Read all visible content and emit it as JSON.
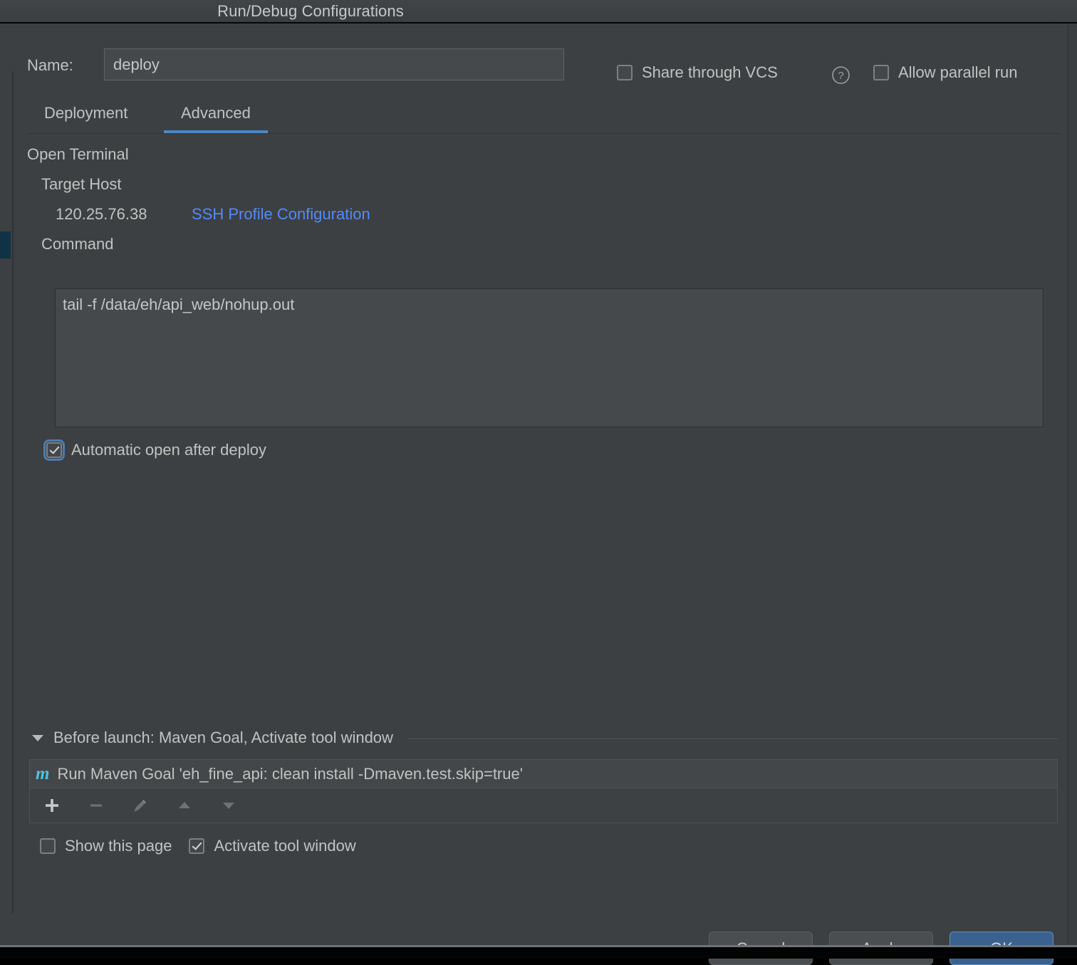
{
  "window": {
    "title": "Run/Debug Configurations"
  },
  "header": {
    "name_label": "Name:",
    "name_value": "deploy",
    "share_vcs_label": "Share through VCS",
    "share_vcs_checked": false,
    "help_icon": "question-circle-icon",
    "allow_parallel_label": "Allow parallel run",
    "allow_parallel_checked": false
  },
  "tabs": [
    {
      "label": "Deployment",
      "selected": false
    },
    {
      "label": "Advanced",
      "selected": true
    }
  ],
  "advanced": {
    "open_terminal_label": "Open Terminal",
    "target_host_label": "Target Host",
    "target_host_value": "120.25.76.38",
    "ssh_profile_link": "SSH Profile Configuration",
    "command_label": "Command",
    "command_value": "tail -f /data/eh/api_web/nohup.out",
    "automatic_open_label": "Automatic open after deploy",
    "automatic_open_checked": true
  },
  "before_launch": {
    "title": "Before launch: Maven Goal, Activate tool window",
    "expanded": true,
    "items": [
      {
        "icon": "maven-icon",
        "text": "Run Maven Goal 'eh_fine_api: clean install -Dmaven.test.skip=true'"
      }
    ],
    "toolbar": [
      {
        "name": "add-button",
        "icon": "plus-icon",
        "enabled": true
      },
      {
        "name": "remove-button",
        "icon": "minus-icon",
        "enabled": false
      },
      {
        "name": "edit-button",
        "icon": "pencil-icon",
        "enabled": false
      },
      {
        "name": "move-up-button",
        "icon": "arrow-up-icon",
        "enabled": false
      },
      {
        "name": "move-down-button",
        "icon": "arrow-down-icon",
        "enabled": false
      }
    ],
    "show_this_page_label": "Show this page",
    "show_this_page_checked": false,
    "activate_tool_window_label": "Activate tool window",
    "activate_tool_window_checked": true
  },
  "footer": {
    "cancel_label": "Cancel",
    "apply_label": "Apply",
    "ok_label": "OK"
  },
  "colors": {
    "accent_blue": "#4a88c7",
    "link_blue": "#548af7",
    "primary_button": "#3b618f",
    "maven_icon": "#4fc3d9",
    "background": "#3c4042",
    "selection": "#103247"
  }
}
